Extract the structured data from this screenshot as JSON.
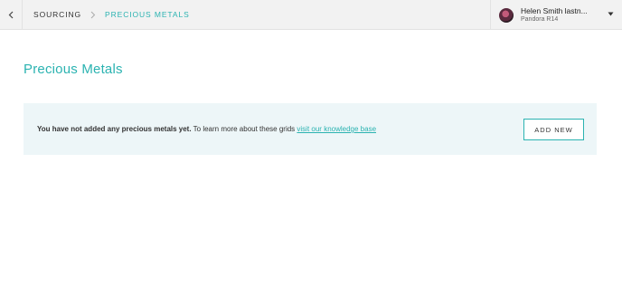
{
  "breadcrumb": {
    "items": [
      "SOURCING",
      "PRECIOUS METALS"
    ]
  },
  "user": {
    "name": "Helen Smith lastn...",
    "org": "Pandora R14"
  },
  "page": {
    "title": "Precious Metals"
  },
  "notice": {
    "message_bold": "You have not added any precious metals yet.",
    "message": "To learn more about these grids",
    "link_label": "visit our knowledge base",
    "add_button_label": "ADD NEW"
  },
  "colors": {
    "accent": "#2bb3b1",
    "notice_bg": "#edf6f8",
    "topbar_bg": "#f2f2f2"
  },
  "icons": [
    "chevron-left-icon",
    "chevron-right-icon",
    "caret-down-icon"
  ]
}
